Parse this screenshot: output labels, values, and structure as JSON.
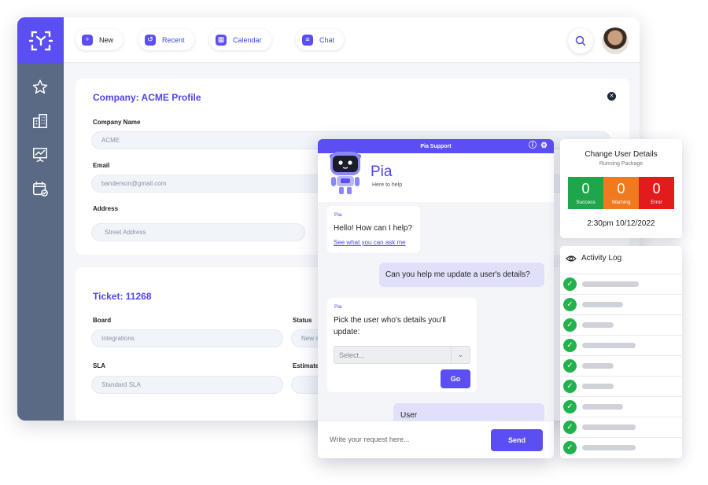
{
  "toolbar": {
    "new_label": "New",
    "recent_label": "Recent",
    "calendar_label": "Calendar",
    "chat_label": "Chat"
  },
  "sidebar": {
    "items": [
      {
        "icon": "star-icon"
      },
      {
        "icon": "buildings-icon"
      },
      {
        "icon": "presentation-chart-icon"
      },
      {
        "icon": "calendar-check-icon"
      }
    ]
  },
  "company_card": {
    "title": "Company: ACME Profile",
    "company_name_label": "Company Name",
    "company_name_value": "ACME",
    "email_label": "Email",
    "email_value": "banderson@gmail.com",
    "address_label": "Address",
    "address_placeholder": "Street Address"
  },
  "ticket_card": {
    "title": "Ticket: 11268",
    "board_label": "Board",
    "board_value": "Integrations",
    "status_label": "Status",
    "status_value": "New s",
    "sla_label": "SLA",
    "sla_value": "Standard SLA",
    "estimate_label": "Estimate"
  },
  "chat": {
    "header_title": "Pia Support",
    "bot_name": "Pia",
    "bot_subtitle": "Here to help",
    "messages": [
      {
        "from": "Pia",
        "text": "Hello! How can I help?",
        "link": "See what you can ask me"
      },
      {
        "from": "user",
        "text": "Can you help me update a user's details?"
      },
      {
        "from": "Pia",
        "text": "Pick the user who's details you'll update:",
        "select_placeholder": "Select...",
        "button": "Go"
      },
      {
        "from": "user",
        "text": "User"
      }
    ],
    "input_placeholder": "Write your request here...",
    "send_label": "Send"
  },
  "status_card": {
    "title": "Change User Details",
    "subtitle": "Running Package",
    "metrics": [
      {
        "value": "0",
        "label": "Success",
        "color": "#1fa64a"
      },
      {
        "value": "0",
        "label": "Warning",
        "color": "#f07a1f"
      },
      {
        "value": "0",
        "label": "Error",
        "color": "#e21c1c"
      }
    ],
    "timestamp": "2:30pm 10/12/2022"
  },
  "activity_log": {
    "title": "Activity Log",
    "entries": 9
  },
  "colors": {
    "accent": "#5b4ef2",
    "sidebar": "#5a6a85",
    "success": "#22b24c"
  }
}
